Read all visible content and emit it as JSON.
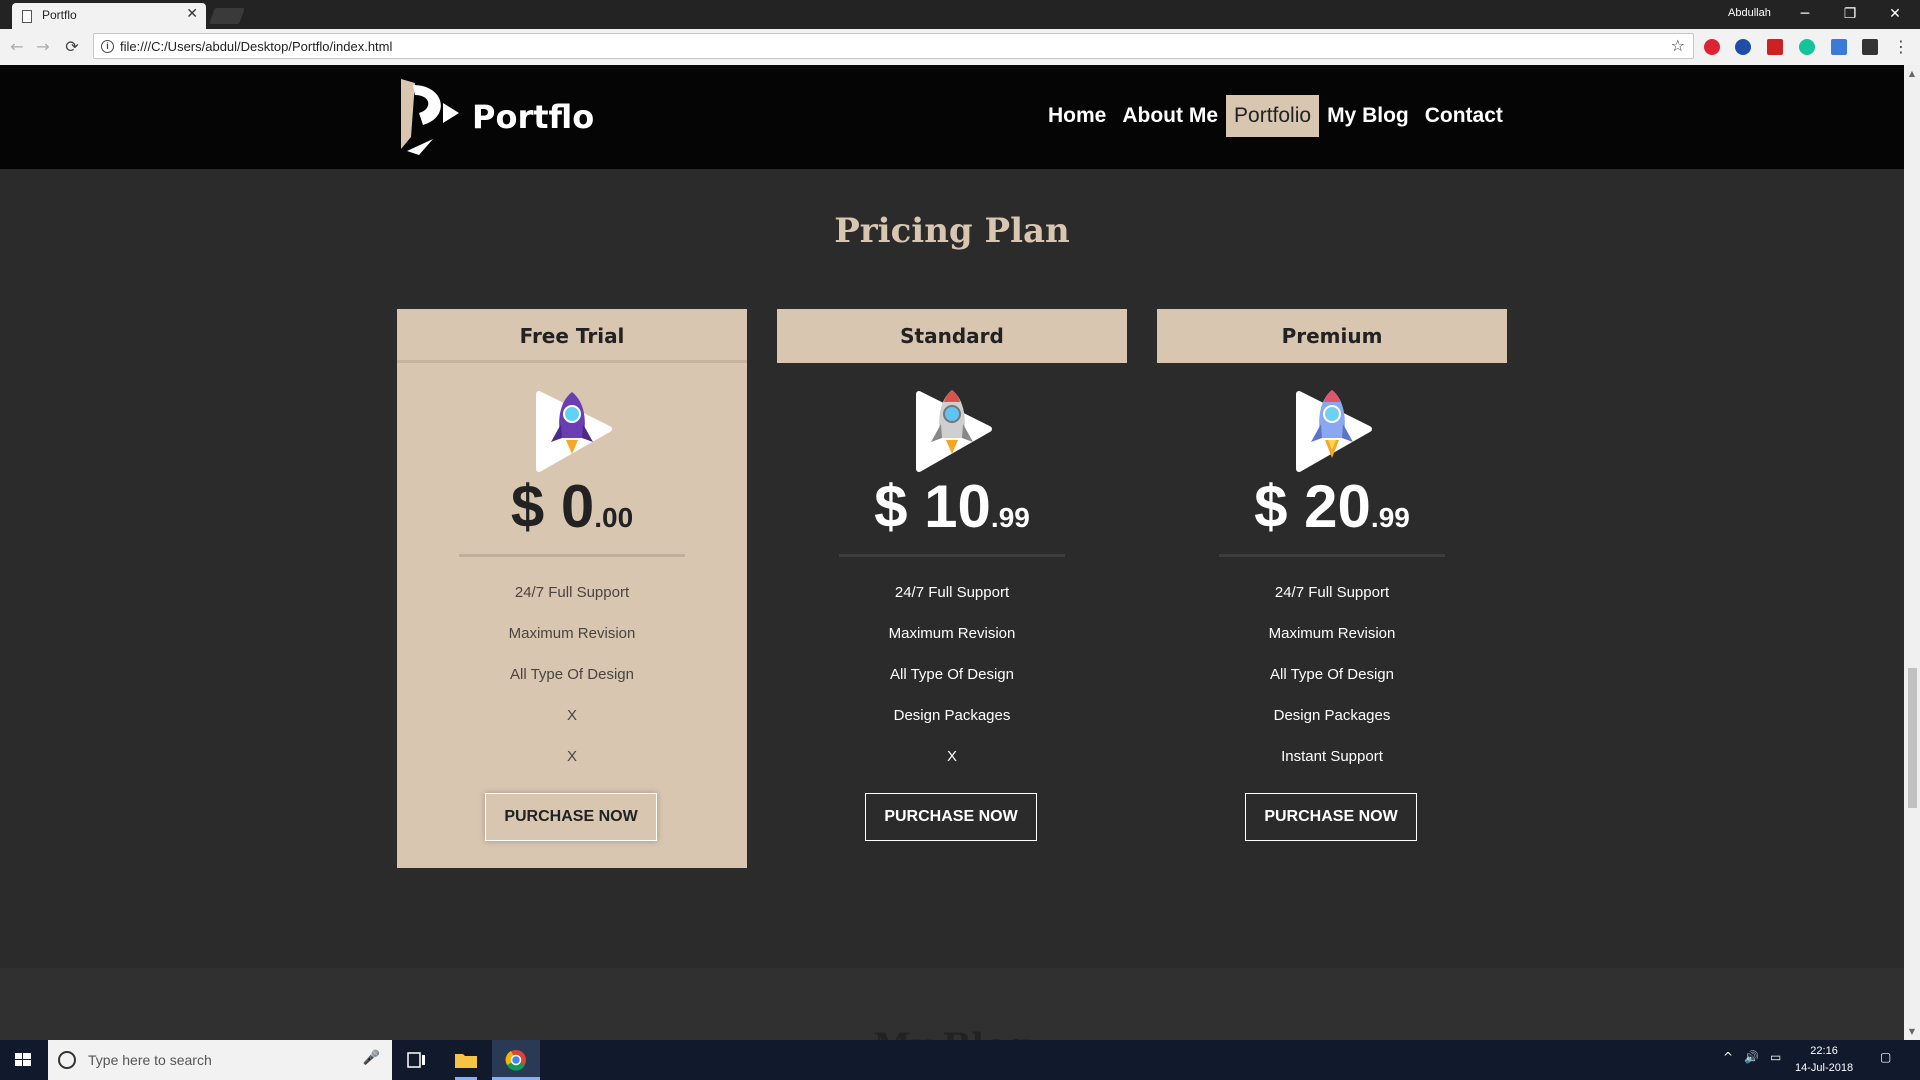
{
  "browser": {
    "tab_title": "Portflo",
    "tab_close": "✕",
    "profile_name": "Abdullah",
    "window_controls": {
      "minimize": "─",
      "restore": "❐",
      "close": "✕"
    },
    "nav": {
      "back": "←",
      "forward": "→",
      "reload": "⟳"
    },
    "url": "file:///C:/Users/abdul/Desktop/Portflo/index.html",
    "info": "i",
    "star": "☆"
  },
  "site": {
    "logo_text": "Portflo",
    "nav_items": [
      {
        "label": "Home"
      },
      {
        "label": "About Me"
      },
      {
        "label": "Portfolio",
        "active": true
      },
      {
        "label": "My Blog"
      },
      {
        "label": "Contact"
      }
    ],
    "accent": "#d8c6b1"
  },
  "pricing": {
    "title": "Pricing Plan",
    "plans": [
      {
        "name": "Free Trial",
        "price_main": "$ 0",
        "price_cents": ".00",
        "features": [
          "24/7 Full Support",
          "Maximum Revision",
          "All Type Of Design",
          "X",
          "X"
        ],
        "button": "PURCHASE NOW",
        "icon": "purple-rocket-icon"
      },
      {
        "name": "Standard",
        "price_main": "$ 10",
        "price_cents": ".99",
        "features": [
          "24/7 Full Support",
          "Maximum Revision",
          "All Type Of Design",
          "Design Packages",
          "X"
        ],
        "button": "PURCHASE NOW",
        "icon": "grey-rocket-icon"
      },
      {
        "name": "Premium",
        "price_main": "$ 20",
        "price_cents": ".99",
        "features": [
          "24/7 Full Support",
          "Maximum Revision",
          "All Type Of Design",
          "Design Packages",
          "Instant Support"
        ],
        "button": "PURCHASE NOW",
        "icon": "blue-rocket-icon"
      }
    ]
  },
  "next_section_peek": "My Blog",
  "taskbar": {
    "search_placeholder": "Type here to search",
    "time": "22:16",
    "date": "14-Jul-2018"
  }
}
